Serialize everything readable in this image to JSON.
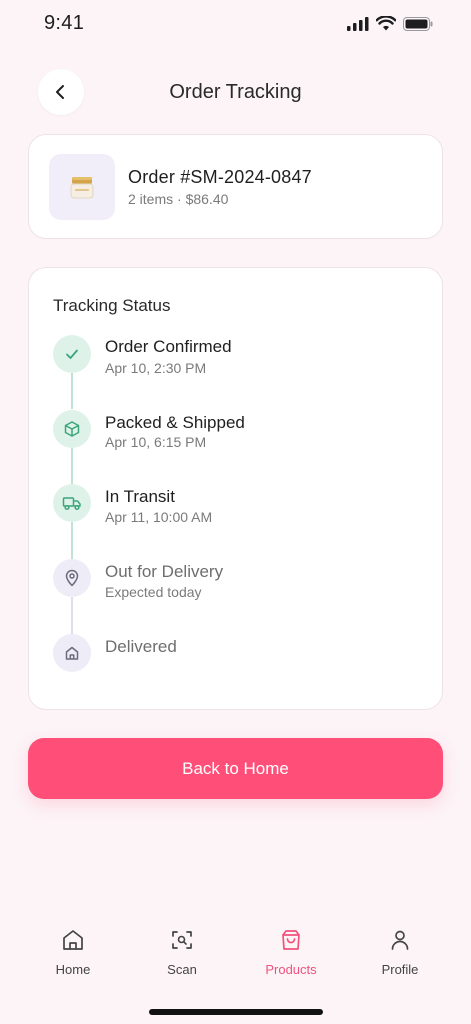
{
  "status_bar": {
    "time": "9:41"
  },
  "header": {
    "title": "Order Tracking",
    "back_icon": "chevron-left-icon"
  },
  "order": {
    "id": "Order #SM-2024-0847",
    "meta": "2 items · $86.40",
    "thumb_icon": "cream-jar-icon"
  },
  "tracking": {
    "title": "Tracking Status",
    "steps": [
      {
        "label": "Order Confirmed",
        "time": "Apr 10, 2:30 PM",
        "state": "done",
        "icon": "check-icon"
      },
      {
        "label": "Packed & Shipped",
        "time": "Apr 10, 6:15 PM",
        "state": "done",
        "icon": "box-icon"
      },
      {
        "label": "In Transit",
        "time": "Apr 11, 10:00 AM",
        "state": "done",
        "icon": "truck-icon"
      },
      {
        "label": "Out for Delivery",
        "time": "Expected today",
        "state": "pending",
        "icon": "location-pin-icon"
      },
      {
        "label": "Delivered",
        "time": "",
        "state": "pending",
        "icon": "home-icon"
      }
    ]
  },
  "actions": {
    "back_home_label": "Back to Home"
  },
  "tabbar": {
    "active": "Products",
    "items": [
      {
        "label": "Home",
        "icon": "home-icon"
      },
      {
        "label": "Scan",
        "icon": "scan-icon"
      },
      {
        "label": "Products",
        "icon": "shopping-bag-icon"
      },
      {
        "label": "Profile",
        "icon": "user-icon"
      }
    ]
  },
  "colors": {
    "accent": "#ff4f78",
    "success": "#3aa57a",
    "success_bg": "#dff2ea",
    "pending_bg": "#eeecf6",
    "background": "#fcf4f7"
  }
}
